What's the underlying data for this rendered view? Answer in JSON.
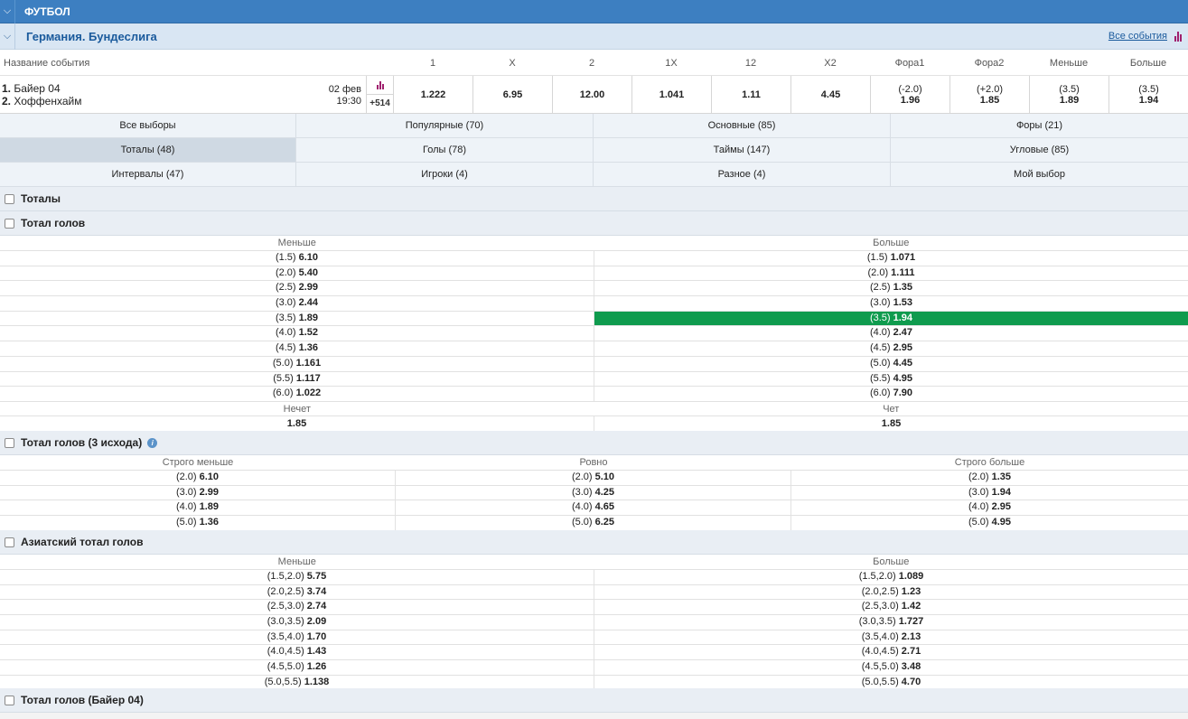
{
  "sport_bar": {
    "title": "ФУТБОЛ",
    "chevron": "chevron-down-icon"
  },
  "league_bar": {
    "title": "Германия. Бундеслига",
    "all_events": "Все события",
    "icon": "bar-chart-icon"
  },
  "columns": {
    "name": "Название события",
    "c1": "1",
    "cx": "X",
    "c2": "2",
    "c1x": "1X",
    "c12": "12",
    "cx2": "X2",
    "fora1": "Фора1",
    "fora2": "Фора2",
    "less": "Меньше",
    "more": "Больше"
  },
  "event": {
    "team1_num": "1.",
    "team1": "Байер 04",
    "team2_num": "2.",
    "team2": "Хоффенхайм",
    "date": "02 фев",
    "time": "19:30",
    "more_count": "+514",
    "odds": {
      "o1": "1.222",
      "ox": "6.95",
      "o2": "12.00",
      "o1x": "1.041",
      "o12": "1.11",
      "ox2": "4.45"
    },
    "fora1": {
      "p": "(-2.0)",
      "v": "1.96"
    },
    "fora2": {
      "p": "(+2.0)",
      "v": "1.85"
    },
    "less": {
      "p": "(3.5)",
      "v": "1.89"
    },
    "more": {
      "p": "(3.5)",
      "v": "1.94"
    }
  },
  "tabs": [
    [
      "Все выборы",
      "Популярные (70)",
      "Основные (85)",
      "Форы (21)"
    ],
    [
      "Тоталы (48)",
      "Голы (78)",
      "Таймы (147)",
      "Угловые (85)"
    ],
    [
      "Интервалы (47)",
      "Игроки (4)",
      "Разное (4)",
      "Мой выбор"
    ]
  ],
  "sections": {
    "totals": "Тоталы",
    "total_goals": "Тотал голов",
    "total_goals_3": "Тотал голов (3 исхода)",
    "asian_total": "Азиатский тотал голов",
    "total_team": "Тотал голов (Байер 04)"
  },
  "total_goals": {
    "head_less": "Меньше",
    "head_more": "Больше",
    "rows": [
      {
        "lp": "(1.5)",
        "lv": "6.10",
        "mp": "(1.5)",
        "mv": "1.071"
      },
      {
        "lp": "(2.0)",
        "lv": "5.40",
        "mp": "(2.0)",
        "mv": "1.111"
      },
      {
        "lp": "(2.5)",
        "lv": "2.99",
        "mp": "(2.5)",
        "mv": "1.35"
      },
      {
        "lp": "(3.0)",
        "lv": "2.44",
        "mp": "(3.0)",
        "mv": "1.53"
      },
      {
        "lp": "(3.5)",
        "lv": "1.89",
        "mp": "(3.5)",
        "mv": "1.94"
      },
      {
        "lp": "(4.0)",
        "lv": "1.52",
        "mp": "(4.0)",
        "mv": "2.47"
      },
      {
        "lp": "(4.5)",
        "lv": "1.36",
        "mp": "(4.5)",
        "mv": "2.95"
      },
      {
        "lp": "(5.0)",
        "lv": "1.161",
        "mp": "(5.0)",
        "mv": "4.45"
      },
      {
        "lp": "(5.5)",
        "lv": "1.117",
        "mp": "(5.5)",
        "mv": "4.95"
      },
      {
        "lp": "(6.0)",
        "lv": "1.022",
        "mp": "(6.0)",
        "mv": "7.90"
      }
    ],
    "odd_label": "Нечет",
    "even_label": "Чет",
    "odd_value": "1.85",
    "even_value": "1.85"
  },
  "total_goals_3": {
    "head_a": "Строго меньше",
    "head_b": "Ровно",
    "head_c": "Строго больше",
    "rows": [
      {
        "ap": "(2.0)",
        "av": "6.10",
        "bp": "(2.0)",
        "bv": "5.10",
        "cp": "(2.0)",
        "cv": "1.35"
      },
      {
        "ap": "(3.0)",
        "av": "2.99",
        "bp": "(3.0)",
        "bv": "4.25",
        "cp": "(3.0)",
        "cv": "1.94"
      },
      {
        "ap": "(4.0)",
        "av": "1.89",
        "bp": "(4.0)",
        "bv": "4.65",
        "cp": "(4.0)",
        "cv": "2.95"
      },
      {
        "ap": "(5.0)",
        "av": "1.36",
        "bp": "(5.0)",
        "bv": "6.25",
        "cp": "(5.0)",
        "cv": "4.95"
      }
    ]
  },
  "asian_total": {
    "head_less": "Меньше",
    "head_more": "Больше",
    "rows": [
      {
        "lp": "(1.5,2.0)",
        "lv": "5.75",
        "mp": "(1.5,2.0)",
        "mv": "1.089"
      },
      {
        "lp": "(2.0,2.5)",
        "lv": "3.74",
        "mp": "(2.0,2.5)",
        "mv": "1.23"
      },
      {
        "lp": "(2.5,3.0)",
        "lv": "2.74",
        "mp": "(2.5,3.0)",
        "mv": "1.42"
      },
      {
        "lp": "(3.0,3.5)",
        "lv": "2.09",
        "mp": "(3.0,3.5)",
        "mv": "1.727"
      },
      {
        "lp": "(3.5,4.0)",
        "lv": "1.70",
        "mp": "(3.5,4.0)",
        "mv": "2.13"
      },
      {
        "lp": "(4.0,4.5)",
        "lv": "1.43",
        "mp": "(4.0,4.5)",
        "mv": "2.71"
      },
      {
        "lp": "(4.5,5.0)",
        "lv": "1.26",
        "mp": "(4.5,5.0)",
        "mv": "3.48"
      },
      {
        "lp": "(5.0,5.5)",
        "lv": "1.138",
        "mp": "(5.0,5.5)",
        "mv": "4.70"
      }
    ]
  },
  "colors": {
    "header_blue": "#3d7fc1",
    "selected_green": "#0f9b4e",
    "league_bg": "#d9e6f3"
  },
  "info_icon": "info-icon"
}
